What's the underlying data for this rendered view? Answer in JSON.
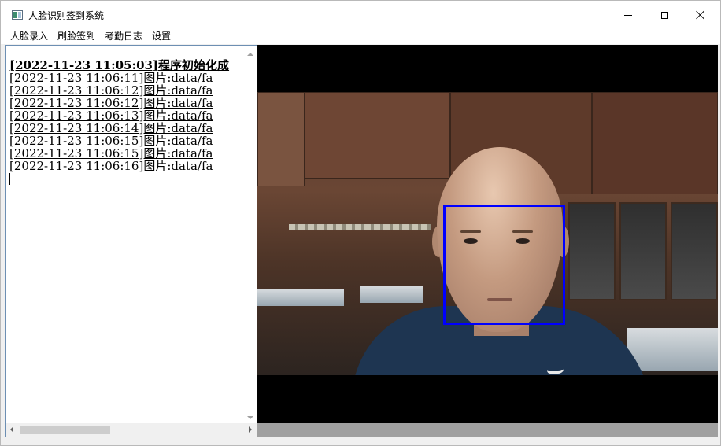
{
  "window": {
    "title": "人脸识别签到系统",
    "controls": {
      "minimize": "minimize",
      "maximize": "maximize",
      "close": "close"
    }
  },
  "menu": {
    "items": [
      {
        "label": "人脸录入"
      },
      {
        "label": "刷脸签到"
      },
      {
        "label": "考勤日志"
      },
      {
        "label": "设置"
      }
    ]
  },
  "log": {
    "lines": [
      "[2022-11-23 11:05:03]程序初始化成",
      "[2022-11-23 11:06:11]图片:data/fa",
      "[2022-11-23 11:06:12]图片:data/fa",
      "[2022-11-23 11:06:12]图片:data/fa",
      "[2022-11-23 11:06:13]图片:data/fa",
      "[2022-11-23 11:06:14]图片:data/fa",
      "[2022-11-23 11:06:15]图片:data/fa",
      "[2022-11-23 11:06:15]图片:data/fa",
      "[2022-11-23 11:06:16]图片:data/fa"
    ]
  },
  "camera": {
    "face_box_color": "#0000ff"
  },
  "colors": {
    "log_border": "#6d8fb3",
    "window_bg": "#f0f0f0"
  }
}
